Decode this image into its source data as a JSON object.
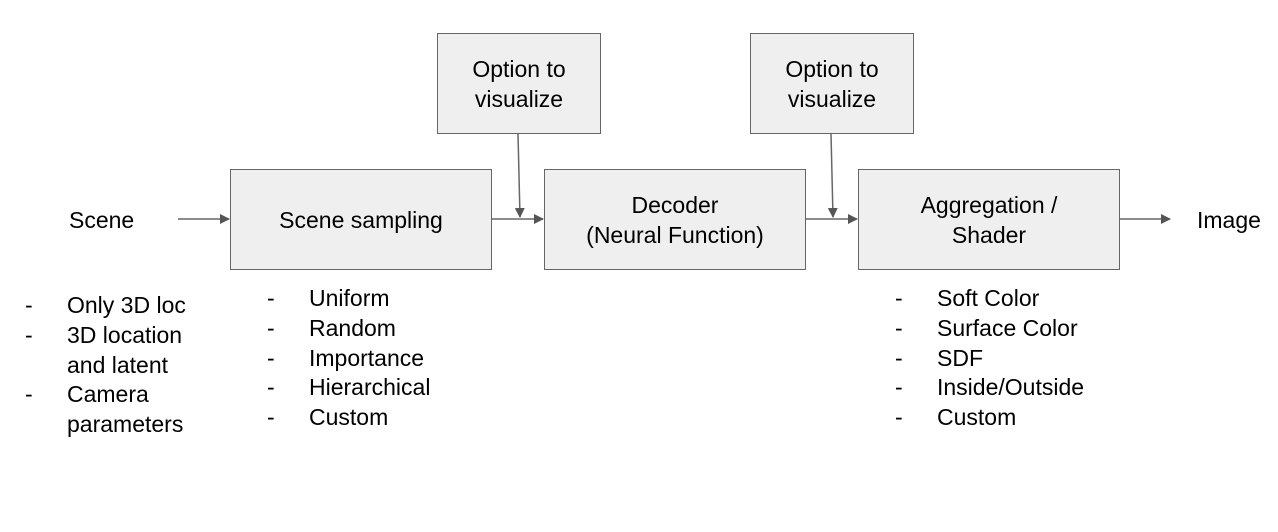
{
  "diagram": {
    "input_label": "Scene",
    "output_label": "Image",
    "boxes": {
      "option1": "Option to visualize",
      "option2": "Option to visualize",
      "sampling": "Scene sampling",
      "decoder_line1": "Decoder",
      "decoder_line2": "(Neural Function)",
      "aggregation_line1": "Aggregation /",
      "aggregation_line2": "Shader"
    },
    "scene_list": [
      "Only 3D loc",
      "3D location and latent",
      "Camera parameters"
    ],
    "sampling_list": [
      "Uniform",
      "Random",
      "Importance",
      "Hierarchical",
      "Custom"
    ],
    "aggregation_list": [
      "Soft Color",
      "Surface Color",
      "SDF",
      "Inside/Outside",
      "Custom"
    ],
    "colors": {
      "box_fill": "#efefef",
      "stroke": "#666666"
    }
  }
}
